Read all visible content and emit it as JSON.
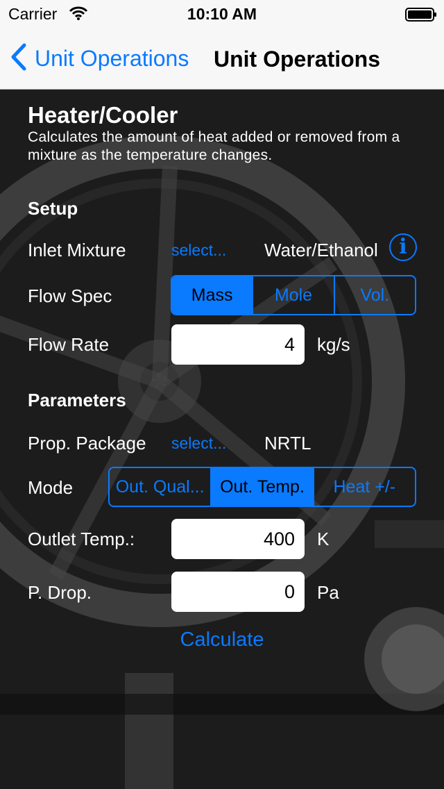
{
  "status_bar": {
    "carrier": "Carrier",
    "time": "10:10 AM"
  },
  "nav": {
    "back_label": "Unit Operations",
    "title": "Unit Operations",
    "back_icon": "chevron-left-icon"
  },
  "header": {
    "title": "Heater/Cooler",
    "description": "Calculates the amount of heat added or removed from a mixture as the temperature changes."
  },
  "setup": {
    "section_label": "Setup",
    "inlet_mixture": {
      "label": "Inlet Mixture",
      "select_label": "select...",
      "value": "Water/Ethanol"
    },
    "flow_spec": {
      "label": "Flow Spec",
      "options": [
        "Mass",
        "Mole",
        "Vol."
      ],
      "selected": "Mass"
    },
    "flow_rate": {
      "label": "Flow Rate",
      "value": "4",
      "unit": "kg/s"
    }
  },
  "parameters": {
    "section_label": "Parameters",
    "prop_package": {
      "label": "Prop. Package",
      "select_label": "select...",
      "value": "NRTL"
    },
    "mode": {
      "label": "Mode",
      "options": [
        "Out. Qual...",
        "Out. Temp.",
        "Heat +/-"
      ],
      "selected": "Out. Temp."
    },
    "outlet_temp": {
      "label": "Outlet Temp.:",
      "value": "400",
      "unit": "K"
    },
    "p_drop": {
      "label": "P. Drop.",
      "value": "0",
      "unit": "Pa"
    }
  },
  "calculate_label": "Calculate",
  "colors": {
    "accent": "#0a7aff",
    "bar_bg": "#f7f7f7"
  }
}
